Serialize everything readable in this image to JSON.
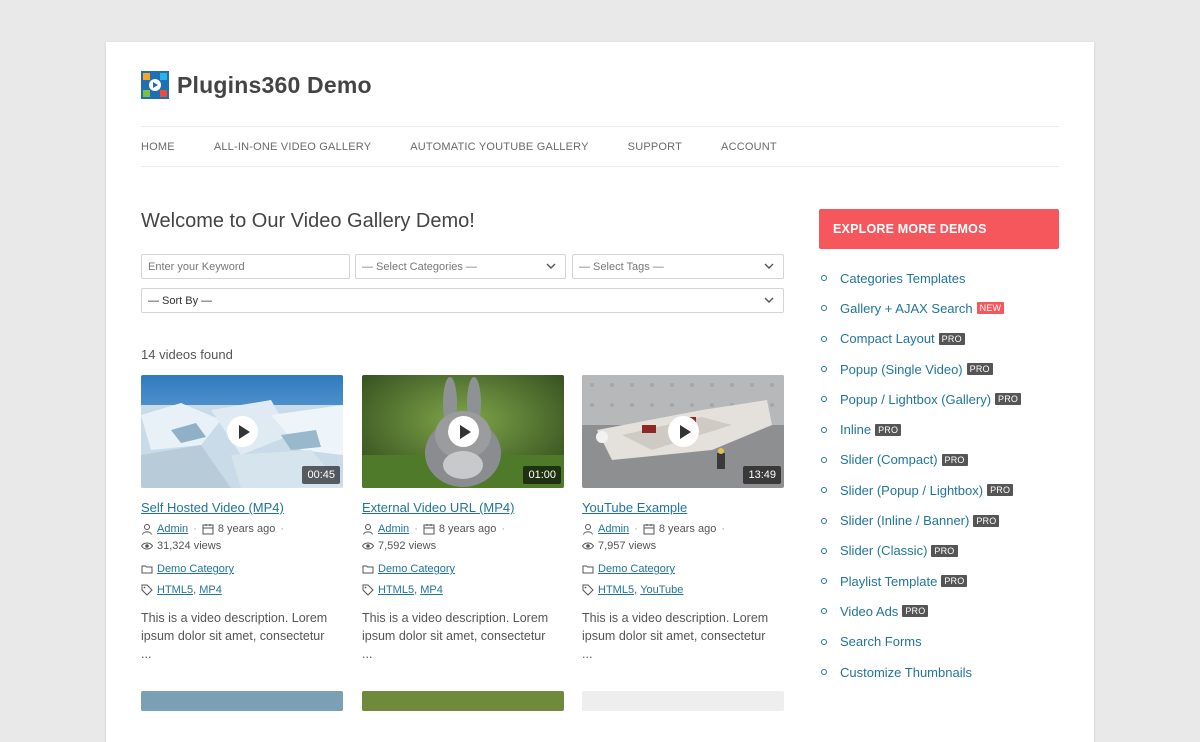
{
  "site": {
    "title": "Plugins360 Demo"
  },
  "nav": [
    "HOME",
    "ALL-IN-ONE VIDEO GALLERY",
    "AUTOMATIC YOUTUBE GALLERY",
    "SUPPORT",
    "ACCOUNT"
  ],
  "main": {
    "heading": "Welcome to Our Video Gallery Demo!",
    "search": {
      "keyword_placeholder": "Enter your Keyword",
      "categories": "— Select Categories —",
      "tags": "— Select Tags —",
      "sort": "— Sort By —"
    },
    "count": "14 videos found",
    "videos": [
      {
        "title": "Self Hosted Video (MP4)",
        "duration": "00:45",
        "author": "Admin",
        "date": "8 years ago",
        "views": "31,324 views",
        "category": "Demo Category",
        "tags": [
          "HTML5",
          "MP4"
        ],
        "description": "This is a video description. Lorem ipsum dolor sit amet, consectetur",
        "ellipsis": "..."
      },
      {
        "title": "External Video URL (MP4)",
        "duration": "01:00",
        "author": "Admin",
        "date": "8 years ago",
        "views": "7,592 views",
        "category": "Demo Category",
        "tags": [
          "HTML5",
          "MP4"
        ],
        "description": "This is a video description. Lorem ipsum dolor sit amet, consectetur",
        "ellipsis": "..."
      },
      {
        "title": "YouTube Example",
        "duration": "13:49",
        "author": "Admin",
        "date": "8 years ago",
        "views": "7,957 views",
        "category": "Demo Category",
        "tags": [
          "HTML5",
          "YouTube"
        ],
        "description": "This is a video description. Lorem ipsum dolor sit amet, consectetur",
        "ellipsis": "..."
      }
    ]
  },
  "sidebar": {
    "heading": "EXPLORE MORE DEMOS",
    "items": [
      {
        "label": "Categories Templates",
        "badge": ""
      },
      {
        "label": "Gallery + AJAX Search",
        "badge": "NEW"
      },
      {
        "label": "Compact Layout",
        "badge": "PRO"
      },
      {
        "label": "Popup (Single Video)",
        "badge": "PRO"
      },
      {
        "label": "Popup / Lightbox (Gallery)",
        "badge": "PRO"
      },
      {
        "label": "Inline",
        "badge": "PRO"
      },
      {
        "label": "Slider (Compact)",
        "badge": "PRO"
      },
      {
        "label": "Slider (Popup / Lightbox)",
        "badge": "PRO"
      },
      {
        "label": "Slider (Inline / Banner)",
        "badge": "PRO"
      },
      {
        "label": "Slider (Classic)",
        "badge": "PRO"
      },
      {
        "label": "Playlist Template",
        "badge": "PRO"
      },
      {
        "label": "Video Ads",
        "badge": "PRO"
      },
      {
        "label": "Search Forms",
        "badge": ""
      },
      {
        "label": "Customize Thumbnails",
        "badge": ""
      }
    ]
  },
  "colors": {
    "accent": "#f5575c",
    "link": "#21759b",
    "badge": "#555555"
  }
}
